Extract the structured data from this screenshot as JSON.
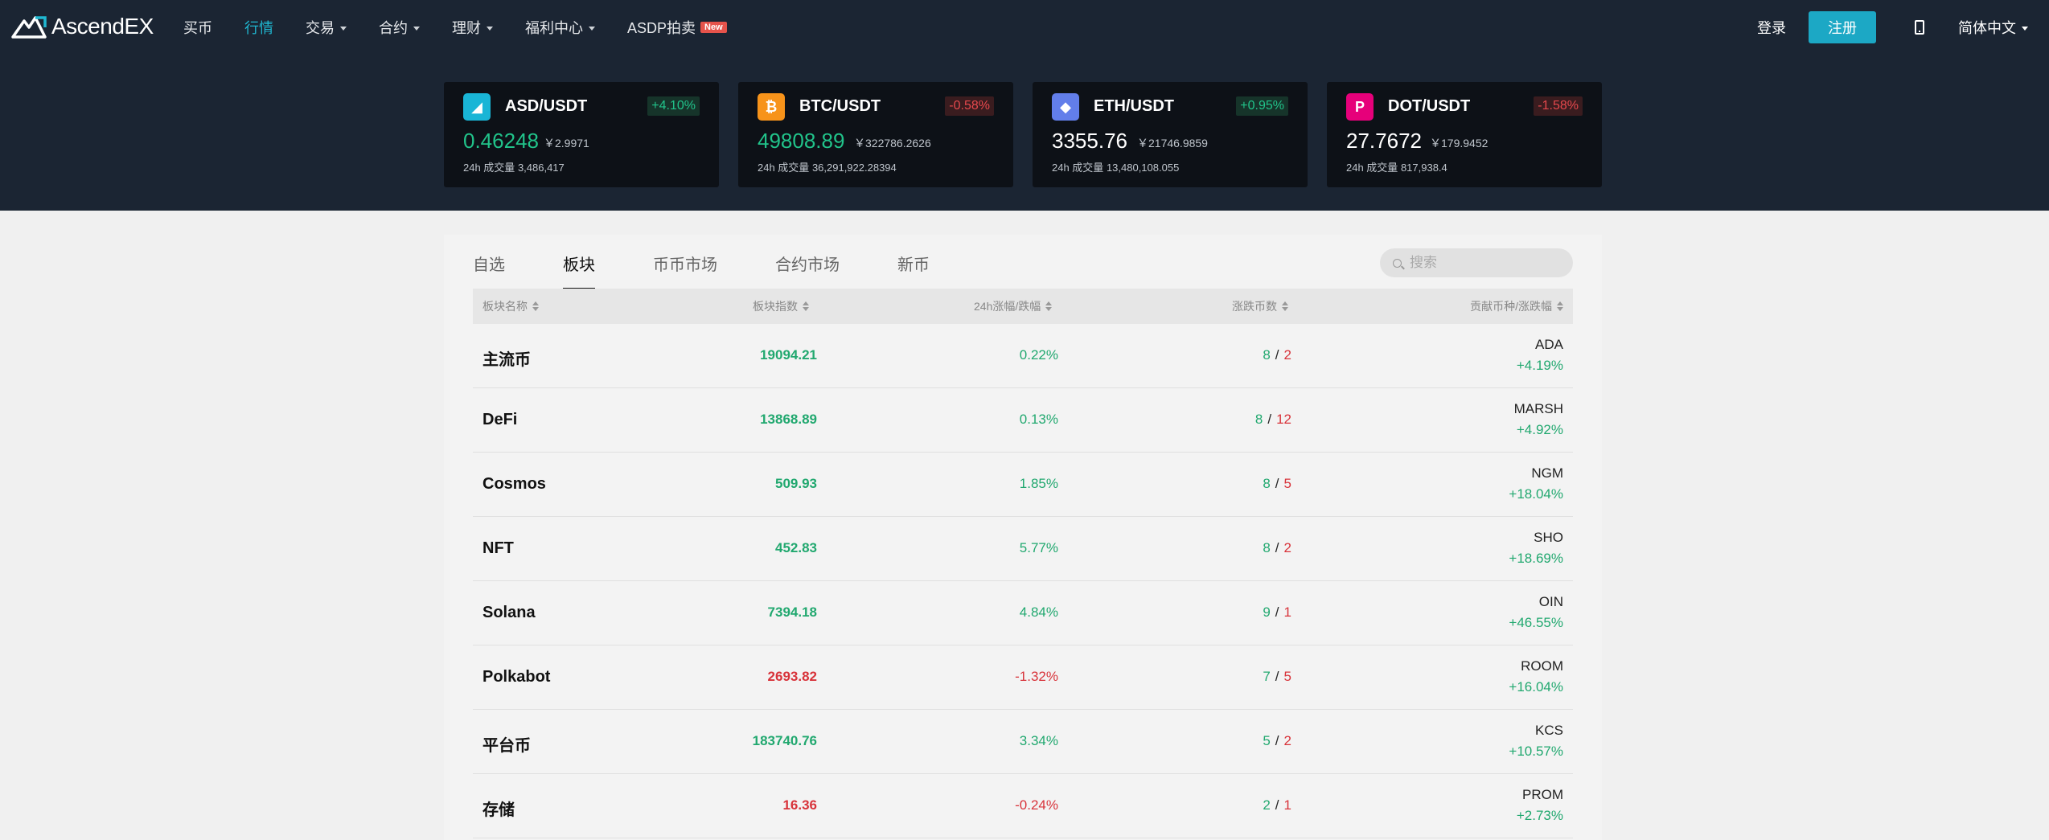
{
  "header": {
    "brand_a": "Ascend",
    "brand_b": "EX",
    "nav": [
      {
        "label": "买币",
        "dropdown": false,
        "active": false
      },
      {
        "label": "行情",
        "dropdown": false,
        "active": true
      },
      {
        "label": "交易",
        "dropdown": true,
        "active": false
      },
      {
        "label": "合约",
        "dropdown": true,
        "active": false
      },
      {
        "label": "理财",
        "dropdown": true,
        "active": false
      },
      {
        "label": "福利中心",
        "dropdown": true,
        "active": false
      },
      {
        "label": "ASDP拍卖",
        "dropdown": false,
        "active": false,
        "badge": "New"
      }
    ],
    "login": "登录",
    "register": "注册",
    "language": "简体中文"
  },
  "tickers": [
    {
      "pair": "ASD/USDT",
      "change": "+4.10%",
      "trend": "up",
      "price": "0.46248",
      "price_color": "up",
      "cny": "￥2.9971",
      "volume_label": "24h 成交量",
      "volume": "3,486,417",
      "icon": "asd-logo-icon",
      "icon_color": "#19b5d6"
    },
    {
      "pair": "BTC/USDT",
      "change": "-0.58%",
      "trend": "down",
      "price": "49808.89",
      "price_color": "up",
      "cny": "￥322786.2626",
      "volume_label": "24h 成交量",
      "volume": "36,291,922.28394",
      "icon": "bitcoin-icon",
      "icon_color": "#f7931a"
    },
    {
      "pair": "ETH/USDT",
      "change": "+0.95%",
      "trend": "up",
      "price": "3355.76",
      "price_color": "white",
      "cny": "￥21746.9859",
      "volume_label": "24h 成交量",
      "volume": "13,480,108.055",
      "icon": "ethereum-icon",
      "icon_color": "#627eea"
    },
    {
      "pair": "DOT/USDT",
      "change": "-1.58%",
      "trend": "down",
      "price": "27.7672",
      "price_color": "white",
      "cny": "￥179.9452",
      "volume_label": "24h 成交量",
      "volume": "817,938.4",
      "icon": "polkadot-icon",
      "icon_color": "#e6007a"
    }
  ],
  "tabs": [
    "自选",
    "板块",
    "币币市场",
    "合约市场",
    "新币"
  ],
  "active_tab": 1,
  "search": {
    "placeholder": "搜索"
  },
  "table": {
    "columns": [
      "板块名称",
      "板块指数",
      "24h涨幅/跌幅",
      "涨跌币数",
      "贡献币种/涨跌幅"
    ],
    "rows": [
      {
        "name": "主流币",
        "index": "19094.21",
        "change": "0.22%",
        "up": "8",
        "down": "2",
        "coin": "ADA",
        "coin_change": "+4.19%",
        "trend": "up"
      },
      {
        "name": "DeFi",
        "index": "13868.89",
        "change": "0.13%",
        "up": "8",
        "down": "12",
        "coin": "MARSH",
        "coin_change": "+4.92%",
        "trend": "up"
      },
      {
        "name": "Cosmos",
        "index": "509.93",
        "change": "1.85%",
        "up": "8",
        "down": "5",
        "coin": "NGM",
        "coin_change": "+18.04%",
        "trend": "up"
      },
      {
        "name": "NFT",
        "index": "452.83",
        "change": "5.77%",
        "up": "8",
        "down": "2",
        "coin": "SHO",
        "coin_change": "+18.69%",
        "trend": "up"
      },
      {
        "name": "Solana",
        "index": "7394.18",
        "change": "4.84%",
        "up": "9",
        "down": "1",
        "coin": "OIN",
        "coin_change": "+46.55%",
        "trend": "up"
      },
      {
        "name": "Polkabot",
        "index": "2693.82",
        "change": "-1.32%",
        "up": "7",
        "down": "5",
        "coin": "ROOM",
        "coin_change": "+16.04%",
        "trend": "down"
      },
      {
        "name": "平台币",
        "index": "183740.76",
        "change": "3.34%",
        "up": "5",
        "down": "2",
        "coin": "KCS",
        "coin_change": "+10.57%",
        "trend": "up"
      },
      {
        "name": "存储",
        "index": "16.36",
        "change": "-0.24%",
        "up": "2",
        "down": "1",
        "coin": "PROM",
        "coin_change": "+2.73%",
        "trend": "down"
      }
    ]
  },
  "colors": {
    "up": "#21a86f",
    "down": "#d8333a",
    "accent": "#1ca8c5",
    "header_bg": "#1b2533"
  }
}
